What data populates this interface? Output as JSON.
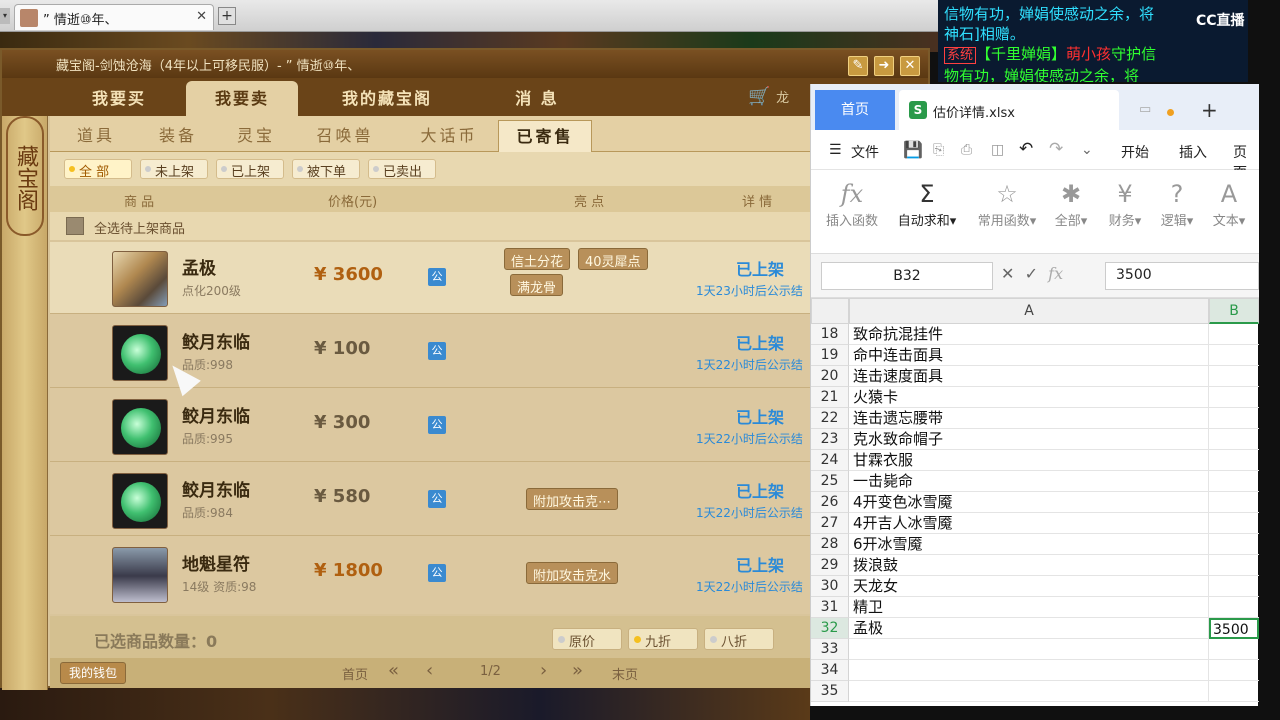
{
  "browser": {
    "tab_title": "” 情逝⑩年、",
    "close": "✕",
    "new_tab": "+"
  },
  "chat": {
    "line1": "信物有功，婵娟使感动之余，将",
    "line2": "神石]相赠。",
    "sys": "系统",
    "line3a": "【千里婵娟】",
    "line3b": "萌",
    "line3c": "小孩",
    "line3d": "守护信",
    "line4": "物有功，婵娟使感动之余，将",
    "cc": "CC直播"
  },
  "panel": {
    "title": "藏宝阁-剑蚀沧海（4年以上可移民服）- ” 情逝⑩年、",
    "tabs": [
      "我要买",
      "我要卖",
      "我的藏宝阁",
      "消 息"
    ],
    "cart_suffix": "龙",
    "seal": "藏宝阁",
    "subtabs": [
      "道具",
      "装备",
      "灵宝",
      "召唤兽",
      "大话币",
      "已寄售"
    ],
    "filters": [
      "全 部",
      "未上架",
      "已上架",
      "被下单",
      "已卖出"
    ],
    "columns": {
      "item": "商 品",
      "price": "价格(元)",
      "highlight": "亮 点",
      "detail": "详 情"
    },
    "select_all": "全选待上架商品",
    "rows": [
      {
        "name": "孟极",
        "sub": "点化200级",
        "price": "¥ 3600",
        "tags": [
          "信土分花",
          "40灵犀点",
          "满龙骨"
        ],
        "status": "已上架",
        "time": "1天23小时后公示结"
      },
      {
        "name": "鲛月东临",
        "sub": "品质:998",
        "price": "¥ 100",
        "tags": [],
        "status": "已上架",
        "time": "1天22小时后公示结"
      },
      {
        "name": "鲛月东临",
        "sub": "品质:995",
        "price": "¥ 300",
        "tags": [],
        "status": "已上架",
        "time": "1天22小时后公示结"
      },
      {
        "name": "鲛月东临",
        "sub": "品质:984",
        "price": "¥ 580",
        "tags": [
          "附加攻击克⋯"
        ],
        "status": "已上架",
        "time": "1天22小时后公示结"
      },
      {
        "name": "地魁星符",
        "sub": "14级  资质:98",
        "price": "¥ 1800",
        "tags": [
          "附加攻击克水"
        ],
        "status": "已上架",
        "time": "1天22小时后公示结"
      }
    ],
    "public_icon": "公",
    "selected_label": "已选商品数量：0",
    "discounts": [
      "原价",
      "九折",
      "八折"
    ],
    "wallet": "我的钱包",
    "pager": {
      "first": "首页",
      "page": "1/2",
      "last": "末页"
    }
  },
  "spreadsheet": {
    "home_tab": "首页",
    "file_tab": "估价详情.xlsx",
    "file_icon": "S",
    "menu": [
      "文件",
      "开始",
      "插入",
      "页面"
    ],
    "ribbon": [
      "插入函数",
      "自动求和▾",
      "常用函数▾",
      "全部▾",
      "财务▾",
      "逻辑▾",
      "文本▾"
    ],
    "ribbon_icons": [
      "fx",
      "Σ",
      "☆",
      "✱",
      "¥",
      "?",
      "A"
    ],
    "name_box": "B32",
    "formula_value": "3500",
    "col_a": "A",
    "col_b": "B",
    "rows": [
      {
        "n": "18",
        "a": "致命抗混挂件",
        "b": ""
      },
      {
        "n": "19",
        "a": "命中连击面具",
        "b": ""
      },
      {
        "n": "20",
        "a": "连击速度面具",
        "b": ""
      },
      {
        "n": "21",
        "a": "火猿卡",
        "b": ""
      },
      {
        "n": "22",
        "a": "连击遗忘腰带",
        "b": ""
      },
      {
        "n": "23",
        "a": "克水致命帽子",
        "b": ""
      },
      {
        "n": "24",
        "a": "甘霖衣服",
        "b": ""
      },
      {
        "n": "25",
        "a": "一击毙命",
        "b": ""
      },
      {
        "n": "26",
        "a": "4开变色冰雪魇",
        "b": ""
      },
      {
        "n": "27",
        "a": "4开吉人冰雪魇",
        "b": ""
      },
      {
        "n": "28",
        "a": "6开冰雪魇",
        "b": ""
      },
      {
        "n": "29",
        "a": "拨浪鼓",
        "b": ""
      },
      {
        "n": "30",
        "a": "天龙女",
        "b": ""
      },
      {
        "n": "31",
        "a": "精卫",
        "b": ""
      },
      {
        "n": "32",
        "a": "孟极",
        "b": "3500"
      },
      {
        "n": "33",
        "a": "",
        "b": ""
      },
      {
        "n": "34",
        "a": "",
        "b": ""
      },
      {
        "n": "35",
        "a": "",
        "b": ""
      }
    ]
  }
}
